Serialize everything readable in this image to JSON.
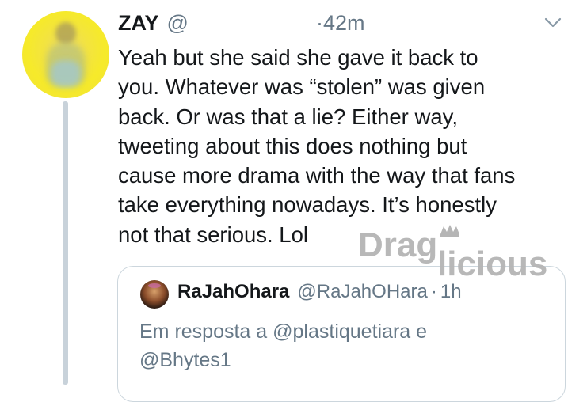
{
  "tweet": {
    "author_name": "ZAY",
    "author_handle": "@",
    "time": "·42m",
    "text": "Yeah but she said she gave it back to\nyou. Whatever was “stolen” was given\nback. Or was that a lie? Either way,\ntweeting about this does nothing but\ncause more drama with the way that fans\ntake everything nowadays. It’s honestly\nnot that serious. Lol",
    "menu_icon": "chevron-down-icon",
    "avatar_icon": "blurred-avatar"
  },
  "watermark": {
    "text": "Draglicious"
  },
  "quoted_tweet": {
    "author_name": "RaJahOhara",
    "author_handle": "@RaJahOHara",
    "separator": "·",
    "time": "1h",
    "reply_context": "Em resposta a @plastiquetiara e\n@Bhytes1"
  },
  "colors": {
    "text_primary": "#14171a",
    "text_secondary": "#657786",
    "thread_line": "#c8d2da",
    "quote_border": "#ccd6dd",
    "watermark": "#b5b5b5"
  }
}
